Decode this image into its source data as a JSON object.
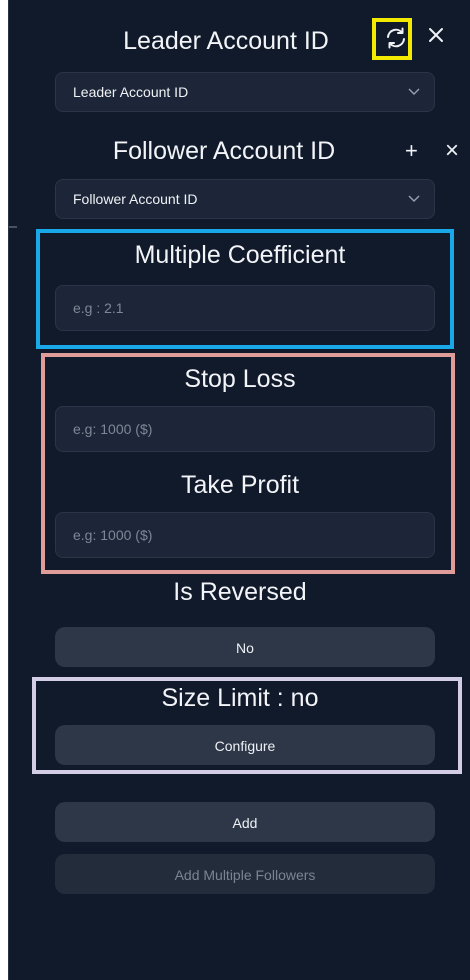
{
  "leader": {
    "title": "Leader Account ID",
    "select_value": "Leader Account ID",
    "refresh_icon": "refresh-icon",
    "close_icon": "close-icon"
  },
  "follower": {
    "title": "Follower Account ID",
    "select_value": "Follower Account ID",
    "add_symbol": "+",
    "close_symbol": "×"
  },
  "multiple_coefficient": {
    "title": "Multiple Coefficient",
    "placeholder": "e.g : 2.1"
  },
  "stop_loss": {
    "title": "Stop Loss",
    "placeholder": "e.g: 1000 ($)"
  },
  "take_profit": {
    "title": "Take Profit",
    "placeholder": "e.g: 1000 ($)"
  },
  "is_reversed": {
    "title": "Is Reversed",
    "button_label": "No"
  },
  "size_limit": {
    "title": "Size Limit : no",
    "button_label": "Configure"
  },
  "actions": {
    "add_label": "Add",
    "add_multiple_label": "Add Multiple Followers"
  },
  "colors": {
    "panel_bg": "#111a2b",
    "field_bg": "#1c2638",
    "button_bg": "#2d3748",
    "highlight_yellow": "#f4ea00",
    "highlight_blue": "#1aa9e8",
    "highlight_pink": "#df9c98",
    "highlight_lavender": "#d4cde6"
  }
}
